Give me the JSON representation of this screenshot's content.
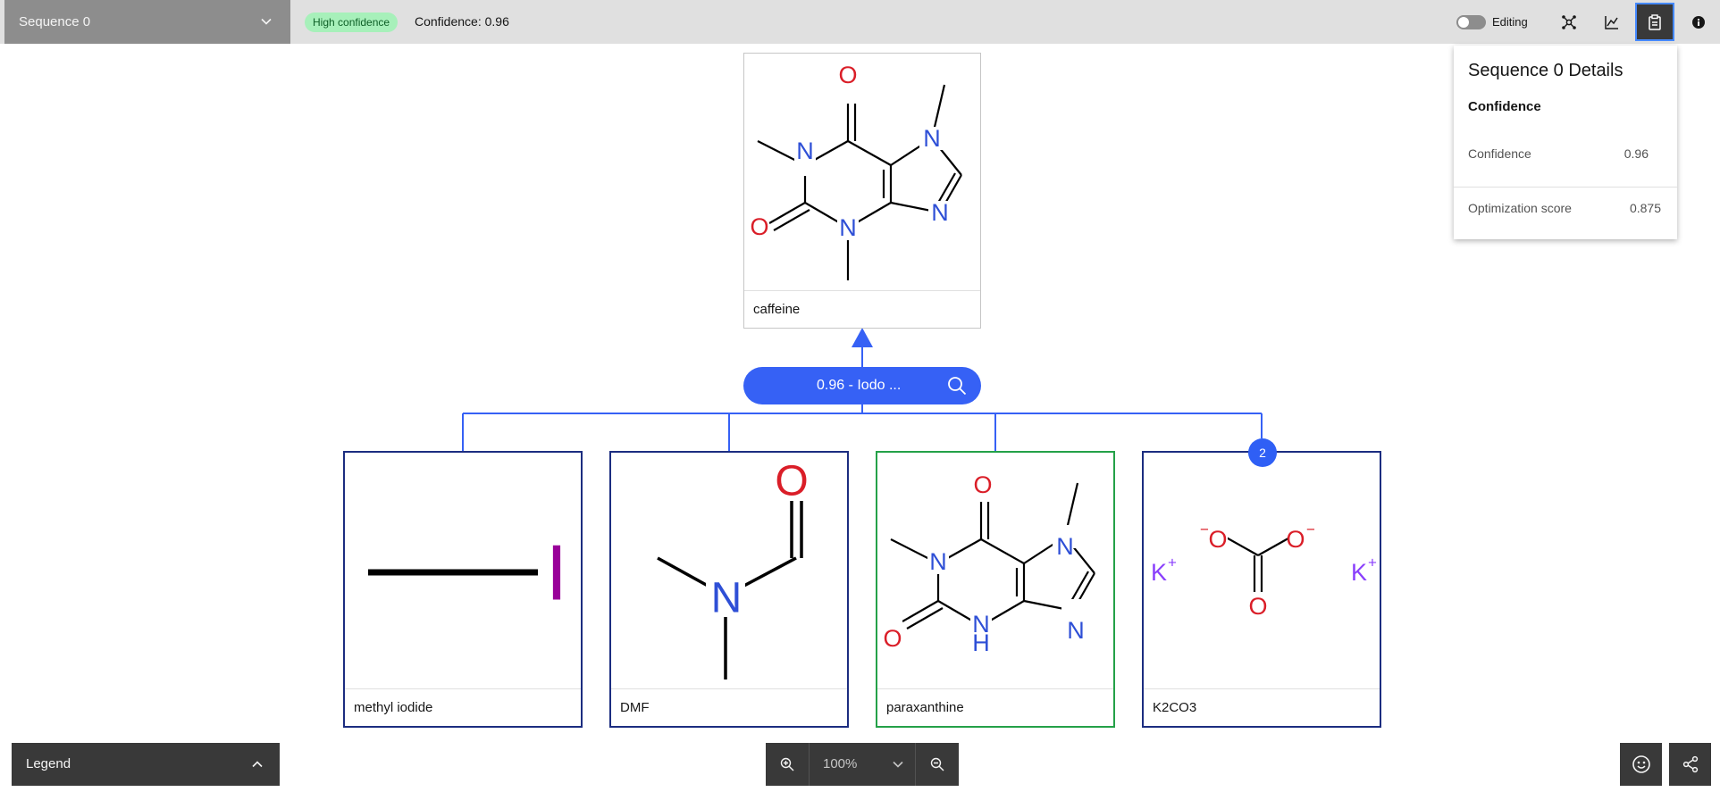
{
  "toolbar": {
    "sequence_select": "Sequence 0",
    "confidence_tag": "High confidence",
    "confidence_text": "Confidence: 0.96",
    "editing_label": "Editing",
    "editing_on": false
  },
  "details_panel": {
    "title": "Sequence 0 Details",
    "section": "Confidence",
    "rows": [
      {
        "label": "Confidence",
        "value": "0.96"
      },
      {
        "label": "Optimization score",
        "value": "0.875"
      }
    ]
  },
  "product": {
    "name": "caffeine"
  },
  "reaction": {
    "label": "0.96 - Iodo ..."
  },
  "reactants": [
    {
      "name": "methyl iodide"
    },
    {
      "name": "DMF"
    },
    {
      "name": "paraxanthine"
    },
    {
      "name": "K2CO3",
      "badge": "2"
    }
  ],
  "atoms": {
    "O": "O",
    "N": "N",
    "H": "H",
    "K": "K",
    "I": "I",
    "plus": "+",
    "minus": "−"
  },
  "bottom": {
    "legend_label": "Legend",
    "zoom_value": "100%"
  },
  "colors": {
    "oxygen": "#da1e28",
    "nitrogen": "#2e4fd6",
    "potassium": "#8a3ffc",
    "iodine": "#990099",
    "reaction_blue": "#3661f5",
    "reactant_border": "#1c2d80",
    "highlight_green": "#24a148"
  }
}
